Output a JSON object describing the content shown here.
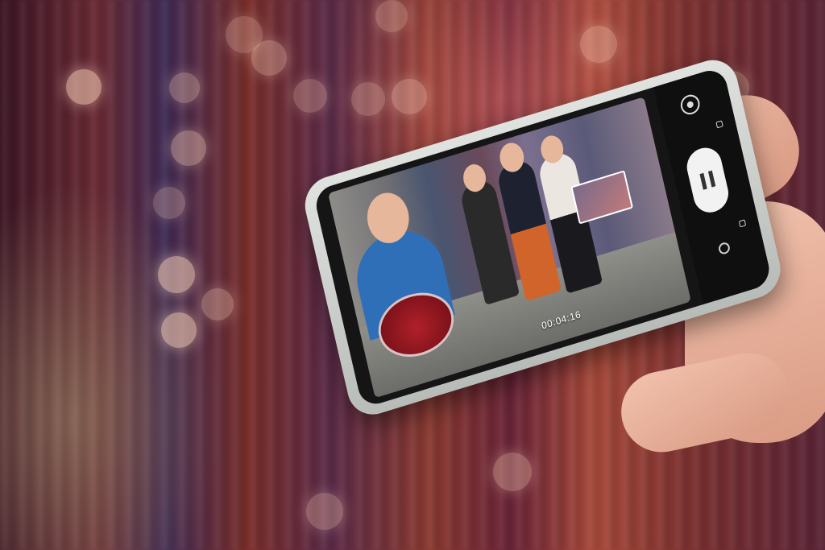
{
  "camera": {
    "recording_timer": "00:04:16",
    "icons": [
      "flip-camera-icon",
      "pause-icon",
      "capture-icon",
      "picture-in-picture-icon"
    ]
  },
  "colors": {
    "background_warm": "#7a2e2a",
    "background_purple": "#3f2a55",
    "phone_frame": "#d7dad6",
    "skin": "#e7b79b"
  }
}
